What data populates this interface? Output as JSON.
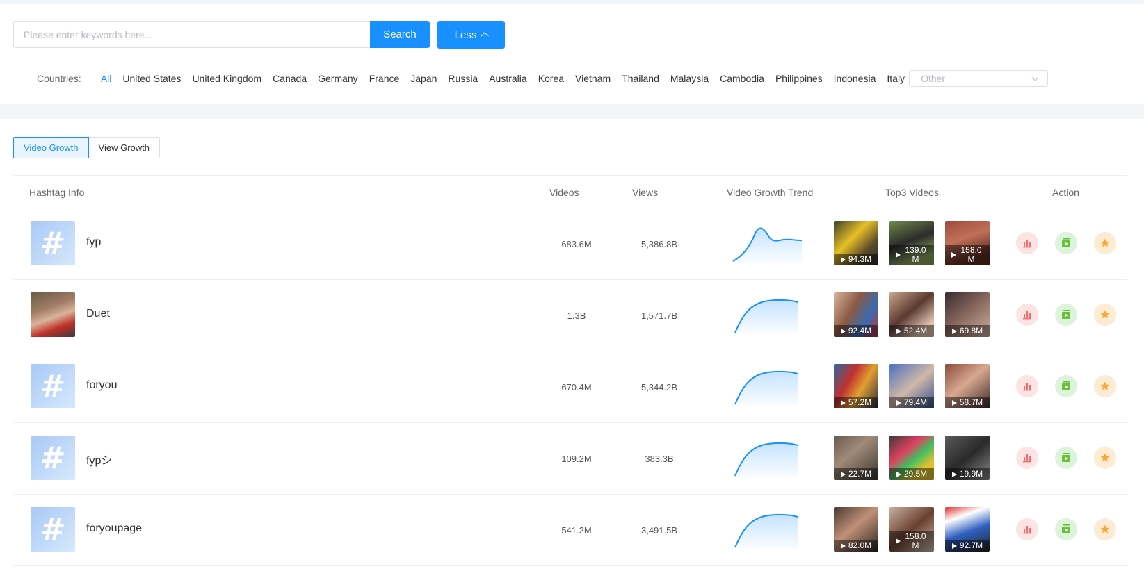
{
  "search": {
    "placeholder": "Please enter keywords here...",
    "button_label": "Search",
    "less_label": "Less"
  },
  "countries": {
    "label": "Countries:",
    "items": [
      "All",
      "United States",
      "United Kingdom",
      "Canada",
      "Germany",
      "France",
      "Japan",
      "Russia",
      "Australia",
      "Korea",
      "Vietnam",
      "Thailand",
      "Malaysia",
      "Cambodia",
      "Philippines",
      "Indonesia",
      "Italy"
    ],
    "active": "All",
    "other_placeholder": "Other"
  },
  "tabs": [
    "Video Growth",
    "View Growth"
  ],
  "table": {
    "headers": {
      "info": "Hashtag Info",
      "videos": "Videos",
      "views": "Views",
      "trend": "Video Growth Trend",
      "top3": "Top3 Videos",
      "action": "Action"
    },
    "rows": [
      {
        "name": "fyp",
        "videos": "683.6M",
        "views": "5,386.8B",
        "thumb": "hash",
        "trend": "peak",
        "top": [
          "94.3M",
          "139.0 M",
          "158.0 M"
        ]
      },
      {
        "name": "Duet",
        "videos": "1.3B",
        "views": "1,571.7B",
        "thumb": "photo",
        "trend": "rise",
        "top": [
          "92.4M",
          "52.4M",
          "69.8M"
        ]
      },
      {
        "name": "foryou",
        "videos": "670.4M",
        "views": "5,344.2B",
        "thumb": "hash",
        "trend": "rise",
        "top": [
          "57.2M",
          "79.4M",
          "58.7M"
        ]
      },
      {
        "name": "fypシ",
        "videos": "109.2M",
        "views": "383.3B",
        "thumb": "hash",
        "trend": "rise",
        "top": [
          "22.7M",
          "29.5M",
          "19.9M"
        ]
      },
      {
        "name": "foryoupage",
        "videos": "541.2M",
        "views": "3,491.5B",
        "thumb": "hash",
        "trend": "rise",
        "top": [
          "82.0M",
          "158.0 M",
          "92.7M"
        ]
      }
    ]
  },
  "colors": {
    "accent": "#1890ff",
    "trend_line": "#1890ff",
    "action_red": "#f56c6c",
    "action_green": "#67c23a",
    "action_orange": "#f7a935"
  }
}
